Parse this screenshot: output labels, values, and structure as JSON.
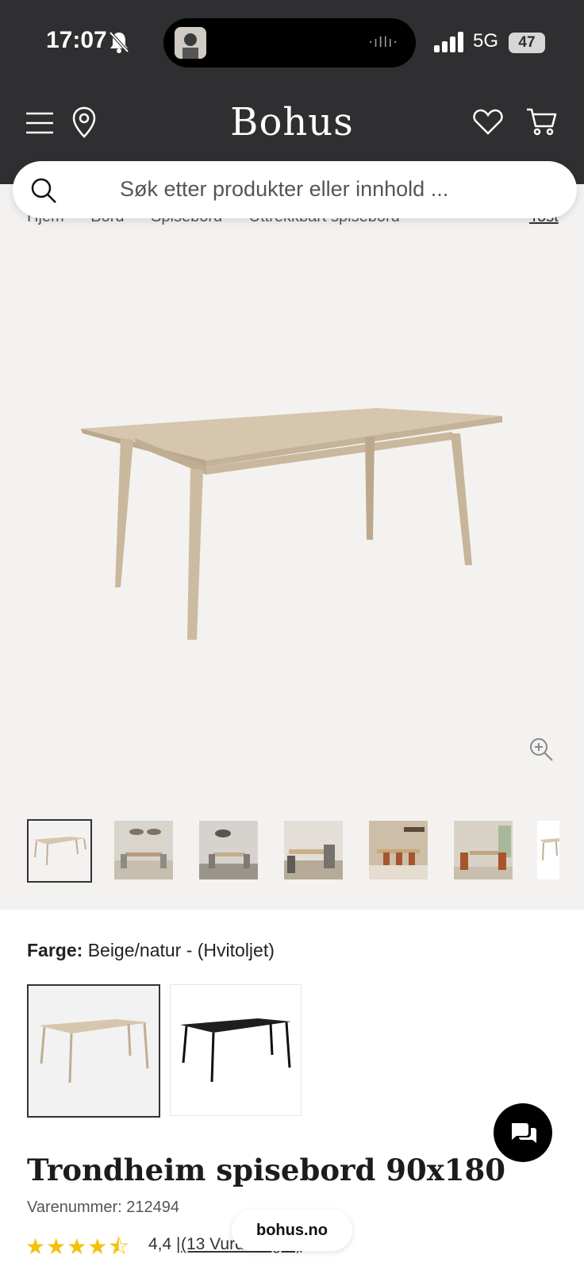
{
  "status_bar": {
    "time": "17:07",
    "network": "5G",
    "battery": "47"
  },
  "header": {
    "logo": "Bohus"
  },
  "search": {
    "placeholder": "Søk etter produkter eller innhold ..."
  },
  "breadcrumb": [
    "Hjem",
    "Bord",
    "Spisebord",
    "Uttrekkbart spisebord"
  ],
  "breadcrumb_right": "Tost",
  "gallery": {
    "thumbnails": [
      "table-front",
      "dining-room-1",
      "dining-room-2",
      "dining-room-3",
      "dining-room-4",
      "dining-room-5",
      "table-front-partial"
    ]
  },
  "product": {
    "color_label": "Farge:",
    "color_value": "Beige/natur - (Hvitoljet)",
    "swatches": [
      {
        "name": "Beige/natur",
        "color": "#d8c9b0",
        "selected": true
      },
      {
        "name": "Sort",
        "color": "#1e1e1e",
        "selected": false
      }
    ],
    "title": "Trondheim spisebord 90x180",
    "sku": "Varenummer: 212494",
    "rating_stars": "★★★★⯪",
    "rating_value": "4,4 |",
    "reviews": "(13 Vurderinger)"
  },
  "browser": {
    "url": "bohus.no"
  },
  "colors": {
    "header_bg": "#2f2f31",
    "page_bg": "#f4f2f0",
    "star": "#f3c10c",
    "wood": "#d8c9b0"
  }
}
